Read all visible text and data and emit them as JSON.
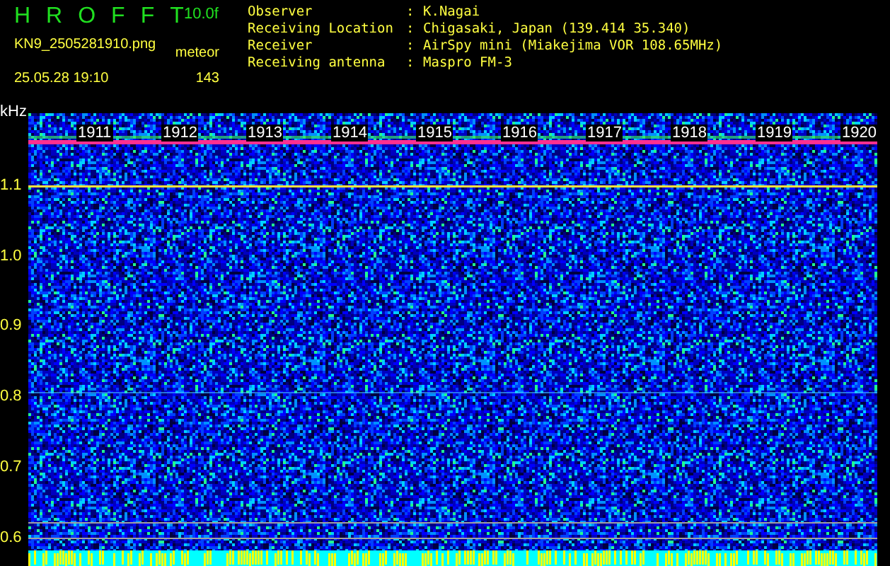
{
  "header": {
    "title": "HROFFT",
    "gain": "10.0f",
    "filename": "KN9_2505281910.png",
    "datetime": "25.05.28 19:10",
    "meteor_label": "meteor",
    "meteor_count": "143"
  },
  "info": [
    {
      "label": "Observer",
      "separator": ":",
      "value": "K.Nagai"
    },
    {
      "label": "Receiving Location",
      "separator": ":",
      "value": "Chigasaki, Japan (139.414 35.340)"
    },
    {
      "label": "Receiver",
      "separator": ":",
      "value": "AirSpy mini (Miakejima VOR 108.65MHz)"
    },
    {
      "label": "Receiving antenna",
      "separator": ":",
      "value": "Maspro FM-3"
    }
  ],
  "spectrogram": {
    "unit": "kHz",
    "y_ticks": [
      "1.1",
      "1.0",
      "0.9",
      "0.8",
      "0.7",
      "0.6"
    ],
    "time_labels": [
      "1911",
      "1912",
      "1913",
      "1914",
      "1915",
      "1916",
      "1917",
      "1918",
      "1919",
      "1920"
    ]
  }
}
